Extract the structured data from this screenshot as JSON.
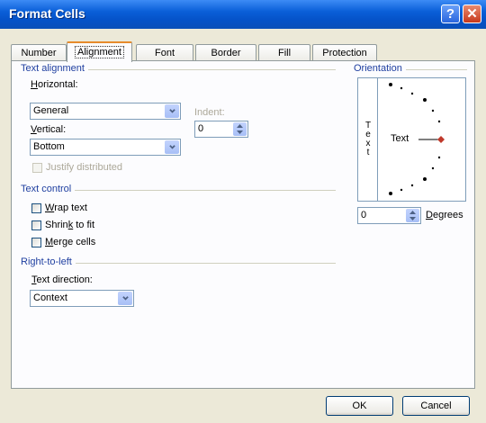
{
  "window": {
    "title": "Format Cells",
    "help_glyph": "?",
    "close_glyph": "✕"
  },
  "tabs": [
    {
      "label": "Number"
    },
    {
      "label": "Alignment",
      "active": true
    },
    {
      "label": "Font"
    },
    {
      "label": "Border"
    },
    {
      "label": "Fill"
    },
    {
      "label": "Protection"
    }
  ],
  "text_alignment": {
    "heading": "Text alignment",
    "horizontal_label_key": "H",
    "horizontal_label_rest": "orizontal:",
    "horizontal_value": "General",
    "indent_label": "Indent:",
    "indent_value": "0",
    "vertical_label_key": "V",
    "vertical_label_rest": "ertical:",
    "vertical_value": "Bottom",
    "justify_distributed": "Justify distributed"
  },
  "text_control": {
    "heading": "Text control",
    "wrap_key": "W",
    "wrap_rest": "rap text",
    "shrink_pre": "Shrin",
    "shrink_key": "k",
    "shrink_rest": " to fit",
    "merge_key": "M",
    "merge_rest": "erge cells"
  },
  "right_to_left": {
    "heading": "Right-to-left",
    "direction_key": "T",
    "direction_rest": "ext direction:",
    "direction_value": "Context"
  },
  "orientation": {
    "heading": "Orientation",
    "vertical_text": [
      "T",
      "e",
      "x",
      "t"
    ],
    "text_label": "Text",
    "degrees_value": "0",
    "degrees_key": "D",
    "degrees_rest": "egrees"
  },
  "buttons": {
    "ok": "OK",
    "cancel": "Cancel"
  },
  "colors": {
    "title_bar": "#0a5fd8",
    "section_heading": "#1f3fa0",
    "active_tab_accent": "#e68b2c",
    "pointer": "#c0392b"
  }
}
